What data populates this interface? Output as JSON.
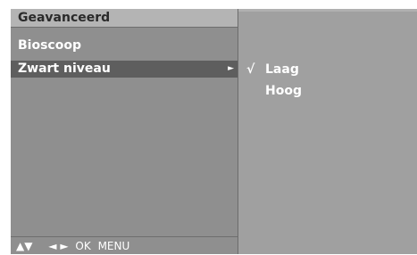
{
  "menu": {
    "title": "Geavanceerd",
    "items": [
      {
        "label": "Bioscoop"
      },
      {
        "label": "Zwart niveau",
        "arrow": "►"
      }
    ]
  },
  "submenu": {
    "options": [
      {
        "check": "√",
        "label": "Laag"
      },
      {
        "check": "",
        "label": "Hoog"
      }
    ]
  },
  "navigation": {
    "up_down": "▲▼",
    "left_right": "◄ ►",
    "ok": "OK",
    "menu": "MENU"
  },
  "colors": {
    "panel": "#8f8f8f",
    "title_bar": "#b4b4b4",
    "highlight": "#5e5e5e",
    "submenu_panel": "#a0a0a0",
    "text": "#ffffff"
  }
}
